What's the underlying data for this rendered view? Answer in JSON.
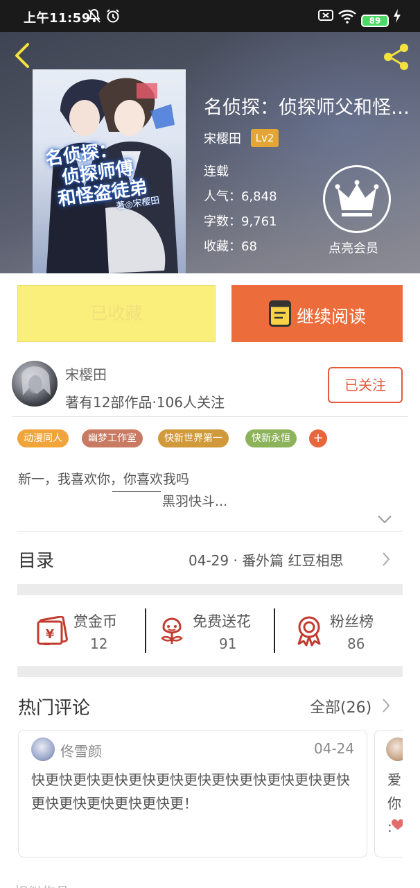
{
  "status_bar": {
    "time": "上午11:59",
    "battery": "89"
  },
  "header": {
    "title": "名侦探：侦探师父和怪…",
    "author": "宋樱田",
    "author_level": "Lv2",
    "status": "连载",
    "popularity": "人气：6,848",
    "word_count": "字数：9,761",
    "collections": "收藏：68",
    "vip_label": "点亮会员",
    "cover": {
      "title_line1": "名侦探：",
      "title_line2": "侦探师傅",
      "title_line3": "和怪盗徒弟",
      "author": "著◎宋樱田"
    }
  },
  "actions": {
    "collect_label": "已收藏",
    "read_label": "继续阅读"
  },
  "author_info": {
    "name": "宋樱田",
    "stats": "著有12部作品·106人关注",
    "follow_label": "已关注"
  },
  "tags": [
    {
      "label": "动漫同人",
      "color": "#f0a43a"
    },
    {
      "label": "幽梦工作室",
      "color": "#c87a62"
    },
    {
      "label": "快新世界第一",
      "color": "#d09a3a"
    },
    {
      "label": "快新永恒",
      "color": "#8cb35a"
    }
  ],
  "tag_more": "+",
  "intro": {
    "line1": "新一，我喜欢你，你喜欢我吗",
    "line2": "黑羽快斗..."
  },
  "toc": {
    "label": "目录",
    "latest": "04-29 · 番外篇  红豆相思"
  },
  "stats": [
    {
      "label": "赏金币",
      "value": "12",
      "icon": "red-envelope-icon"
    },
    {
      "label": "免费送花",
      "value": "91",
      "icon": "flower-icon"
    },
    {
      "label": "粉丝榜",
      "value": "86",
      "icon": "medal-icon"
    }
  ],
  "comments": {
    "title": "热门评论",
    "all_label": "全部(26)",
    "items": [
      {
        "user": "佟雪颜",
        "date": "04-24",
        "text": "快更快更快更快更快更快更快更快更快更快更快更快更快更快更快更快更快更！"
      },
      {
        "line1": "爱",
        "line2": "你",
        "line3": ":"
      }
    ]
  },
  "bottom_peek": "相似作品",
  "colors": {
    "accent": "#ec6c3b",
    "collect_bg": "#fbef7b",
    "follow": "#e35a3a",
    "icon_red": "#c23b2f"
  }
}
